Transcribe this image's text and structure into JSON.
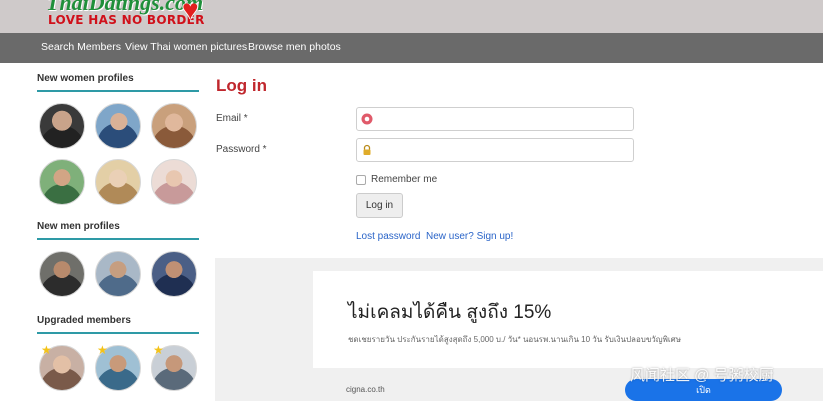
{
  "header": {
    "logo_title": "ThaiDatings.com",
    "logo_tagline": "LOVE HAS NO BORDER",
    "logo_icon": "heart-icon"
  },
  "nav": {
    "items": [
      "Search Members",
      "View Thai women pictures",
      "Browse men photos"
    ]
  },
  "sidebar": {
    "women_title": "New women profiles",
    "men_title": "New men profiles",
    "upgraded_title": "Upgraded members",
    "accent_color": "#2e9aa6"
  },
  "login": {
    "title": "Log in",
    "email_label": "Email *",
    "email_value": "",
    "password_label": "Password *",
    "password_value": "",
    "remember_label": "Remember me",
    "remember_checked": false,
    "submit_label": "Log in",
    "lost_password": "Lost password",
    "signup": "New user? Sign up!",
    "title_color": "#c0272d",
    "link_color": "#2a64c8"
  },
  "ad": {
    "headline": "ไม่เคลมได้คืน สูงถึง 15%",
    "subtext": "ชดเชยรายวัน ประกันรายได้สูงสุดถึง 5,000 บ./ วัน* นอนรพ.นานเกิน 10 วัน รับเงินปลอบขวัญพิเศษ",
    "domain": "cigna.co.th",
    "cta": "เปิด",
    "cta_color": "#1a73e8"
  },
  "watermark": "风闻社区 @ 号粥校厨"
}
